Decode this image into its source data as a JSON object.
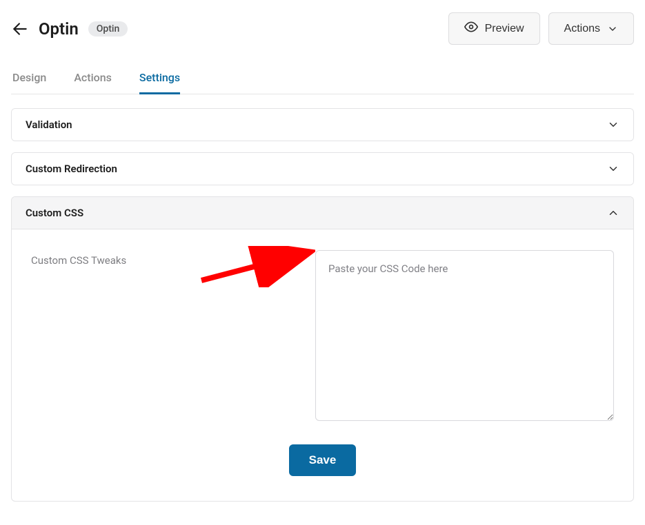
{
  "header": {
    "title": "Optin",
    "badge": "Optin",
    "preview": "Preview",
    "actions": "Actions"
  },
  "tabs": {
    "design": "Design",
    "actions": "Actions",
    "settings": "Settings"
  },
  "panels": {
    "validation": {
      "title": "Validation"
    },
    "custom_redirection": {
      "title": "Custom Redirection"
    },
    "custom_css": {
      "title": "Custom CSS",
      "field_label": "Custom CSS Tweaks",
      "placeholder": "Paste your CSS Code here",
      "value": ""
    }
  },
  "buttons": {
    "save": "Save"
  }
}
